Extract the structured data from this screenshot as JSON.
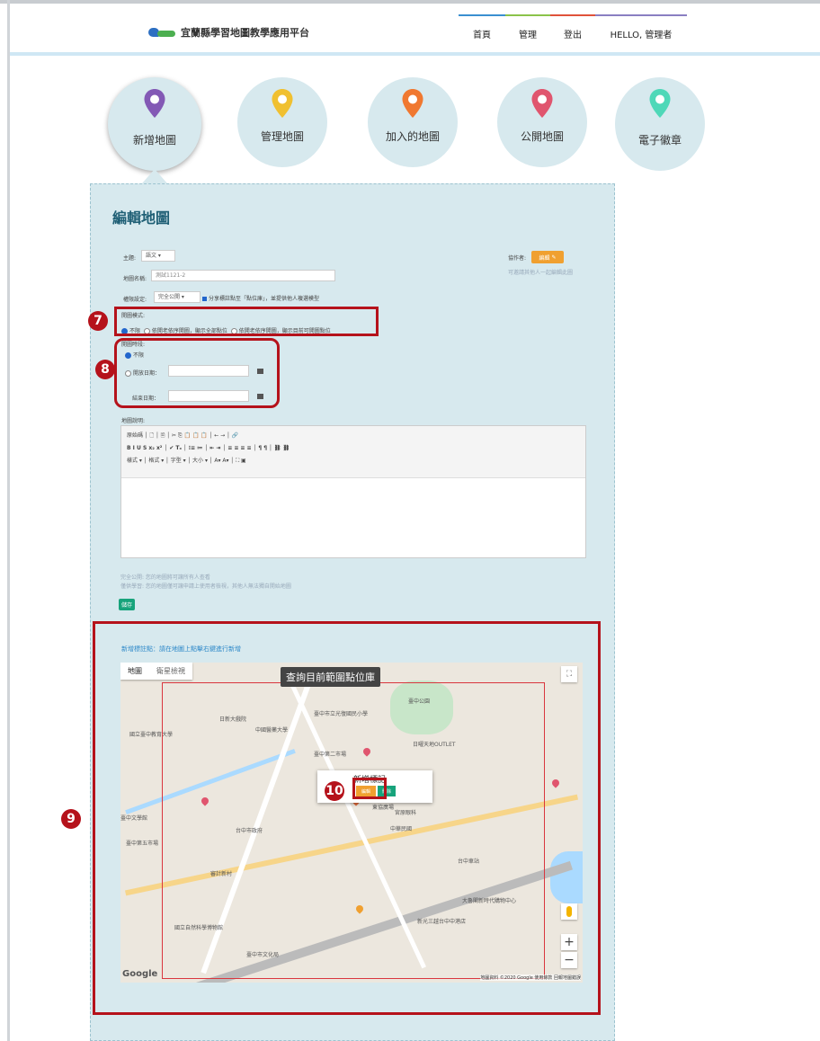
{
  "header": {
    "logo_text": "宜蘭縣學習地圖教學應用平台",
    "nav": [
      {
        "label": "首頁",
        "color": "#3a8fd0"
      },
      {
        "label": "管理",
        "color": "#8bc34a"
      },
      {
        "label": "登出",
        "color": "#e0523a"
      },
      {
        "label": "HELLO, 管理者",
        "color": "#8a7fc2"
      }
    ]
  },
  "circles": [
    {
      "label": "新增地圖",
      "color": "#8359b5",
      "icon": "map-pin-icon"
    },
    {
      "label": "管理地圖",
      "color": "#f0c030",
      "icon": "map-pin-icon"
    },
    {
      "label": "加入的地圖",
      "color": "#f07830",
      "icon": "map-pin-icon"
    },
    {
      "label": "公開地圖",
      "color": "#e0556e",
      "icon": "map-pin-icon"
    },
    {
      "label": "電子徽章",
      "color": "#4fd8b8",
      "icon": "map-pin-icon"
    }
  ],
  "form": {
    "title": "編輯地圖",
    "subject_label": "主題:",
    "subject_value": "語文",
    "map_name_label": "地圖名稱:",
    "map_name_value": "測試1121-2",
    "permission_label": "權限設定:",
    "permission_value": "完全公開",
    "share_text": "分享標註點至「點位庫」，並提供他人複選模型",
    "open_mode_label": "開圖模式:",
    "open_mode_options": [
      "不限",
      "依開老依序開圖，顯示全部點位",
      "依開老依序開圖，顯示目前可開圖點位"
    ],
    "open_period_label": "開圖時段:",
    "open_period_none": "不限",
    "start_date_label": "開放日期：",
    "end_date_label": "結束日期：",
    "coauthor_label": "協作者:",
    "coauthor_button": "編輯",
    "coauthor_hint": "可邀請其他人一起編輯此圖",
    "description_label": "地圖說明:",
    "editor_toolbar_row1": "原始碼 │ 🗋 │ 🗎 │ ✂ ⎘ 📋 📋 📋 │ ← → │ 🔗",
    "editor_toolbar_row2": "B  I  U  S  x₂  x²  │ ✔  Tₓ │ ⁝≡ ≔ │ ⇤ ⇥ │ ≡ ≡ ≡ ≡ │ ¶ ¶ │ ⛓ ⛓",
    "editor_toolbar_row3": "樣式      ▾ │ 格式      ▾ │ 字型      ▾ │ 大小      ▾ │ A▾ A▾ │ ⛶ ▣",
    "note1": "完全公開: 您的地圖將可讓所有人查看",
    "note2": "僅供學習: 您的地圖僅可讓申請上使用者檢視，其他人無法獨自開始地圖",
    "save_button": "儲存"
  },
  "map_section": {
    "heading": "新增標註點：請在地圖上點擊右鍵進行新增",
    "tab_map": "地圖",
    "tab_satellite": "衛星檢視",
    "query_button": "查詢目前範圍點位庫",
    "popup_title": "新增標記",
    "popup_edit": "編輯",
    "popup_delete": "刪除",
    "google": "Google",
    "copyright": "地圖資料 ©2020 Google  使用條款  回報地圖錯誤",
    "labels": [
      "日新大戲院",
      "國立臺中教育大學",
      "中國醫藥大學",
      "臺中市立光復國民小學",
      "臺中公園",
      "日曜天地OUTLET",
      "臺中第二市場",
      "臺中文學館",
      "台中市政府",
      "臺中第五市場",
      "中華民國",
      "審計新村",
      "台中車站",
      "大魯閣新時代購物中心",
      "新光三越台中中港店",
      "宮原眼科",
      "國立自然科學博物館",
      "臺中市文化局",
      "東協廣場"
    ]
  },
  "annotations": [
    "7",
    "8",
    "9",
    "10"
  ]
}
